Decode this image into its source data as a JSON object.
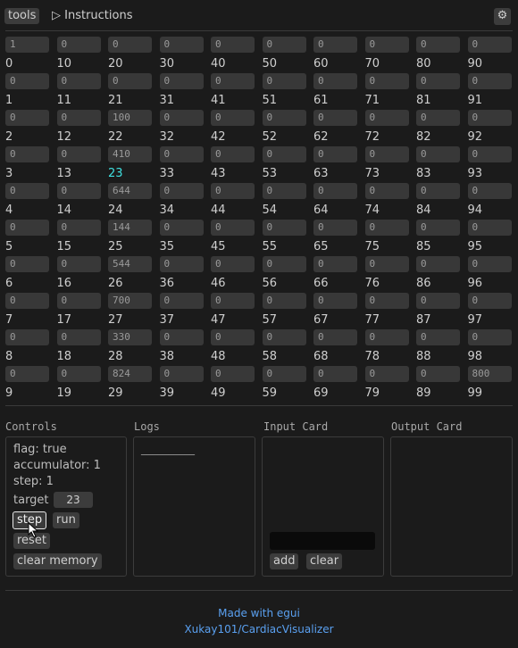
{
  "header": {
    "tools": "tools",
    "instructions": "▷ Instructions",
    "gear_icon": "gear-icon"
  },
  "memory": [
    "1",
    "0",
    "0",
    "0",
    "0",
    "0",
    "0",
    "0",
    "0",
    "0",
    "0",
    "0",
    "0",
    "0",
    "0",
    "0",
    "0",
    "0",
    "0",
    "0",
    "0",
    "0",
    "100",
    "410",
    "644",
    "144",
    "544",
    "700",
    "330",
    "824",
    "0",
    "0",
    "0",
    "0",
    "0",
    "0",
    "0",
    "0",
    "0",
    "0",
    "0",
    "0",
    "0",
    "0",
    "0",
    "0",
    "0",
    "0",
    "0",
    "0",
    "0",
    "0",
    "0",
    "0",
    "0",
    "0",
    "0",
    "0",
    "0",
    "0",
    "0",
    "0",
    "0",
    "0",
    "0",
    "0",
    "0",
    "0",
    "0",
    "0",
    "0",
    "0",
    "0",
    "0",
    "0",
    "0",
    "0",
    "0",
    "0",
    "0",
    "0",
    "0",
    "0",
    "0",
    "0",
    "0",
    "0",
    "0",
    "0",
    "0",
    "0",
    "0",
    "0",
    "0",
    "0",
    "0",
    "0",
    "0",
    "0",
    "800"
  ],
  "highlighted_address": 23,
  "controls": {
    "title": "Controls",
    "flag": "flag: true",
    "accumulator": "accumulator: 1",
    "step": "step: 1",
    "target_label": "target",
    "target_value": "23",
    "step_btn": "step",
    "run_btn": "run",
    "reset_btn": "reset",
    "clear_memory_btn": "clear memory"
  },
  "logs": {
    "title": "Logs",
    "entries": [
      "__________"
    ]
  },
  "input_card": {
    "title": "Input Card",
    "value": "",
    "add_btn": "add",
    "clear_btn": "clear"
  },
  "output_card": {
    "title": "Output Card"
  },
  "footer": {
    "made_with": "Made with egui",
    "repo": "Xukay101/CardiacVisualizer"
  },
  "colors": {
    "highlight": "#3fe0e0",
    "link": "#5aa0f0"
  }
}
